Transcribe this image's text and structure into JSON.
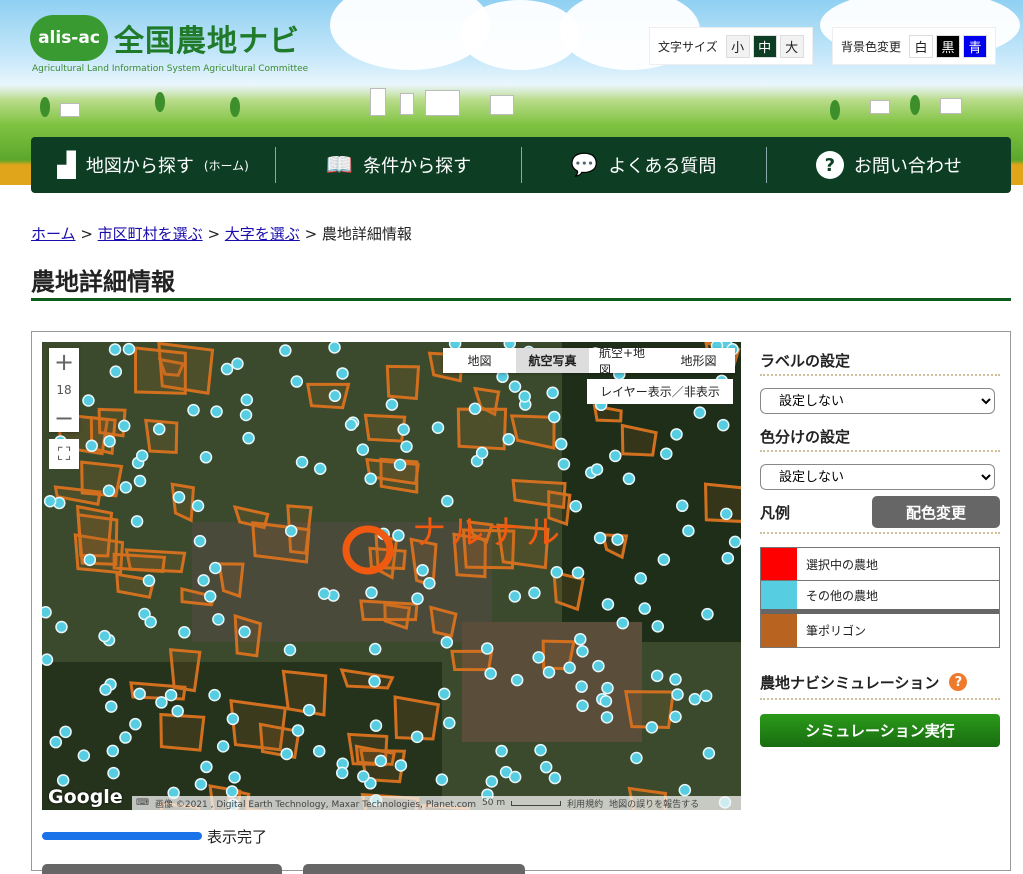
{
  "header": {
    "logo_badge": "alis-ac",
    "logo_name": "全国農地ナビ",
    "logo_sub": "Agricultural Land Information System Agricultural Committee",
    "font_size": {
      "label": "文字サイズ",
      "options": [
        "小",
        "中",
        "大"
      ],
      "selected": "中"
    },
    "bg_color": {
      "label": "背景色変更",
      "options": [
        "白",
        "黒",
        "青"
      ]
    }
  },
  "nav": [
    {
      "label": "地図から探す",
      "sub": "(ホーム)",
      "icon": "japan-map-icon"
    },
    {
      "label": "条件から探す",
      "icon": "book-search-icon"
    },
    {
      "label": "よくある質問",
      "icon": "chat-bubbles-icon"
    },
    {
      "label": "お問い合わせ",
      "icon": "question-circle-icon"
    }
  ],
  "breadcrumb": [
    "ホーム",
    "市区町村を選ぶ",
    "大字を選ぶ",
    "農地詳細情報"
  ],
  "page_title": "農地詳細情報",
  "map": {
    "zoom_level": "18",
    "zoom_in": "+",
    "zoom_out": "−",
    "map_types": [
      "地図",
      "航空写真",
      "航空+地図",
      "地形図"
    ],
    "selected_type": "航空写真",
    "layer_toggle": "レイヤー表示／非表示",
    "google": "Google",
    "attribution": "画像 ©2021 , Digital Earth Technology, Maxar Technologies, Planet.com",
    "scale": "50 m",
    "terms": "利用規約",
    "report": "地図の誤りを報告する",
    "annotation": "ナルナル"
  },
  "progress": {
    "value": 1.0,
    "label": "表示完了"
  },
  "side": {
    "label_setting": "ラベルの設定",
    "label_value": "設定しない",
    "color_setting": "色分けの設定",
    "color_value": "設定しない",
    "legend": "凡例",
    "recolor": "配色変更",
    "legend_items": [
      {
        "label": "選択中の農地",
        "color": "#ff0000"
      },
      {
        "label": "その他の農地",
        "color": "#56cde0"
      },
      {
        "label": "筆ポリゴン",
        "color": "#b86320"
      }
    ],
    "sim_title": "農地ナビシミュレーション",
    "sim_help": "?",
    "sim_button": "シミュレーション実行"
  }
}
